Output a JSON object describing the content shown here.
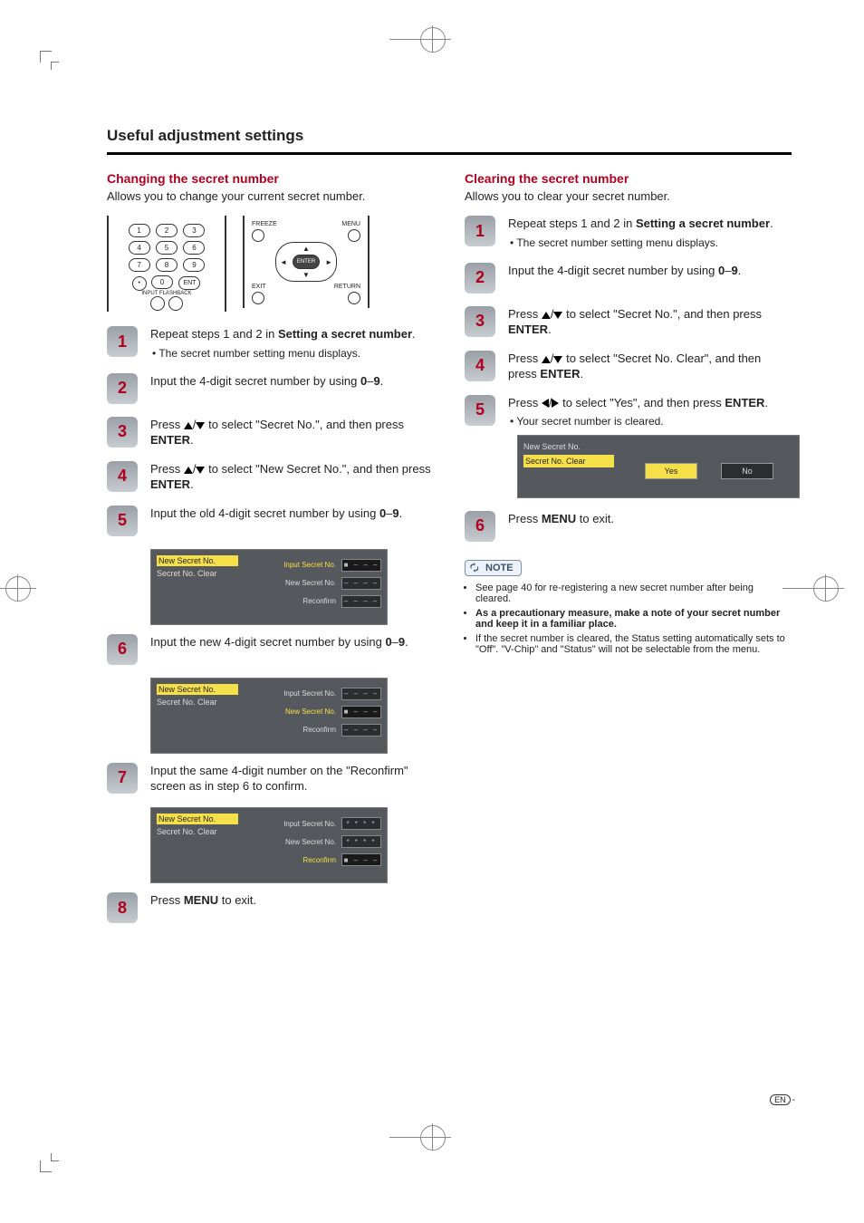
{
  "section_title": "Useful adjustment settings",
  "left": {
    "heading": "Changing the secret number",
    "lead": "Allows you to change your current secret number.",
    "remote": {
      "keys": [
        "1",
        "2",
        "3",
        "4",
        "5",
        "6",
        "7",
        "8",
        "9",
        "0"
      ],
      "ent_label": "ENT",
      "input_flashback": "INPUT FLASHBACK",
      "freeze": "FREEZE",
      "menu": "MENU",
      "enter": "ENTER",
      "exit": "EXIT",
      "return": "RETURN"
    },
    "steps": [
      {
        "n": "1",
        "text_a": "Repeat steps 1 and 2 in ",
        "bold": "Setting a secret number",
        "text_b": ".",
        "bullet": "The secret number setting menu displays."
      },
      {
        "n": "2",
        "text": "Input the 4-digit secret number by using ",
        "bold": "0",
        "dash": "–",
        "bold2": "9",
        "tail": "."
      },
      {
        "n": "3",
        "pre": "Press ",
        "arrows": "ud",
        "mid": " to select \"Secret No.\", and then press ",
        "enter": "ENTER",
        "post": "."
      },
      {
        "n": "4",
        "pre": "Press ",
        "arrows": "ud",
        "mid": " to select \"New Secret No.\", and then press ",
        "enter": "ENTER",
        "post": "."
      },
      {
        "n": "5",
        "text": "Input the old 4-digit secret number by using ",
        "bold": "0",
        "dash": "–",
        "bold2": "9",
        "tail": "."
      },
      {
        "n": "6",
        "text": "Input the new 4-digit secret number by using ",
        "bold": "0",
        "dash": "–",
        "bold2": "9",
        "tail": "."
      },
      {
        "n": "7",
        "text": "Input the same 4-digit number on the \"Reconfirm\" screen as in step 6 to confirm."
      },
      {
        "n": "8",
        "pre": "Press ",
        "enter": "MENU",
        "post": " to exit."
      }
    ],
    "osd": {
      "menu_items": [
        "New Secret No.",
        "Secret No. Clear"
      ],
      "rows": [
        "Input Secret No.",
        "New Secret No.",
        "Reconfirm"
      ],
      "placeholder_filled": "■ – – –",
      "placeholder_empty": "– – – –",
      "placeholder_stars": "* * * *"
    }
  },
  "right": {
    "heading": "Clearing the secret number",
    "lead": "Allows you to clear your secret number.",
    "steps": [
      {
        "n": "1",
        "text_a": "Repeat steps 1 and 2 in ",
        "bold": "Setting a secret number",
        "text_b": ".",
        "bullet": "The secret number setting menu displays."
      },
      {
        "n": "2",
        "text": "Input the 4-digit secret number by using ",
        "bold": "0",
        "dash": "–",
        "bold2": "9",
        "tail": "."
      },
      {
        "n": "3",
        "pre": "Press ",
        "arrows": "ud",
        "mid": " to select \"Secret No.\", and then press ",
        "enter": "ENTER",
        "post": "."
      },
      {
        "n": "4",
        "pre": "Press ",
        "arrows": "ud",
        "mid": " to select \"Secret No. Clear\", and then press  ",
        "enter": "ENTER",
        "post": "."
      },
      {
        "n": "5",
        "pre": "Press ",
        "arrows": "lr",
        "mid": " to select \"Yes\", and then press ",
        "enter": "ENTER",
        "post": ".",
        "bullet": "Your secret number is cleared."
      },
      {
        "n": "6",
        "pre": "Press ",
        "enter": "MENU",
        "post": " to exit."
      }
    ],
    "osd": {
      "menu_items": [
        "New Secret No.",
        "Secret No. Clear"
      ],
      "yes": "Yes",
      "no": "No"
    },
    "note_label": "NOTE",
    "notes": [
      "See page 40 for re-registering a new secret number after being cleared.",
      "As a precautionary measure, make a note of your secret number and keep it in a familiar place.",
      "If the secret number is cleared, the Status setting automatically sets to \"Off\". \"V-Chip\" and \"Status\" will not be selectable from the menu."
    ],
    "notes_bold_index": 1
  },
  "footer_en": "EN",
  "footer_dash": "-"
}
